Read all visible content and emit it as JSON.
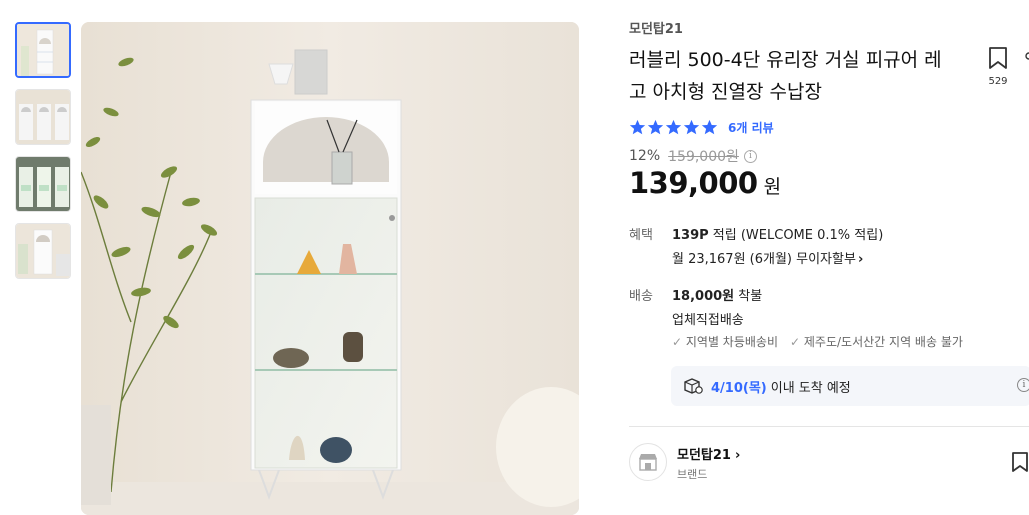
{
  "thumbnails": [
    {
      "alt": "thumb-1",
      "active": true
    },
    {
      "alt": "thumb-2",
      "active": false
    },
    {
      "alt": "thumb-3",
      "active": false
    },
    {
      "alt": "thumb-4",
      "active": false
    }
  ],
  "product": {
    "brand": "모던탑21",
    "title": "러블리 500-4단 유리장 거실 피규어 레고 아치형 진열장 수납장",
    "bookmark_count": "529",
    "rating_stars": 5,
    "review_text": "6개 리뷰",
    "discount_rate": "12%",
    "original_price": "159,000원",
    "price": "139,000",
    "price_unit": "원"
  },
  "benefit": {
    "label": "혜택",
    "points": "139P",
    "points_rest": " 적립 (WELCOME 0.1% 적립)",
    "installment": "월 23,167원 (6개월) 무이자할부",
    "installment_arrow": "›"
  },
  "shipping": {
    "label": "배송",
    "fee": "18,000원",
    "fee_rest": " 착불",
    "method": "업체직접배송",
    "notes": [
      "지역별 차등배송비",
      "제주도/도서산간 지역 배송 불가"
    ],
    "arrival_date": "4/10(목)",
    "arrival_rest": "이내 도착 예정"
  },
  "store": {
    "name": "모던탑21",
    "arrow": "›",
    "sub": "브랜드"
  },
  "colors": {
    "accent": "#346aff",
    "star": "#346aff"
  }
}
